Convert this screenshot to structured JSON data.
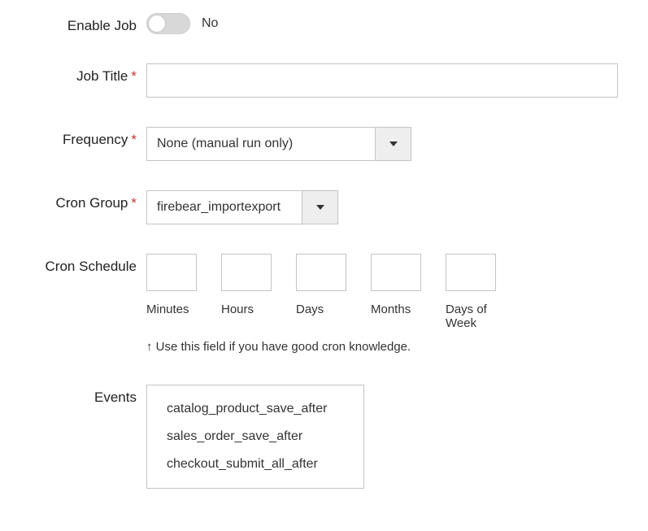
{
  "enableJob": {
    "label": "Enable Job",
    "state": "No"
  },
  "jobTitle": {
    "label": "Job Title",
    "value": ""
  },
  "frequency": {
    "label": "Frequency",
    "value": "None (manual run only)"
  },
  "cronGroup": {
    "label": "Cron Group",
    "value": "firebear_importexport"
  },
  "cronSchedule": {
    "label": "Cron Schedule",
    "items": [
      {
        "value": "",
        "caption": "Minutes"
      },
      {
        "value": "",
        "caption": "Hours"
      },
      {
        "value": "",
        "caption": "Days"
      },
      {
        "value": "",
        "caption": "Months"
      },
      {
        "value": "",
        "caption": "Days of Week"
      }
    ],
    "hint": "↑ Use this field if you have good cron knowledge."
  },
  "events": {
    "label": "Events",
    "options": [
      "catalog_product_save_after",
      "sales_order_save_after",
      "checkout_submit_all_after"
    ]
  }
}
